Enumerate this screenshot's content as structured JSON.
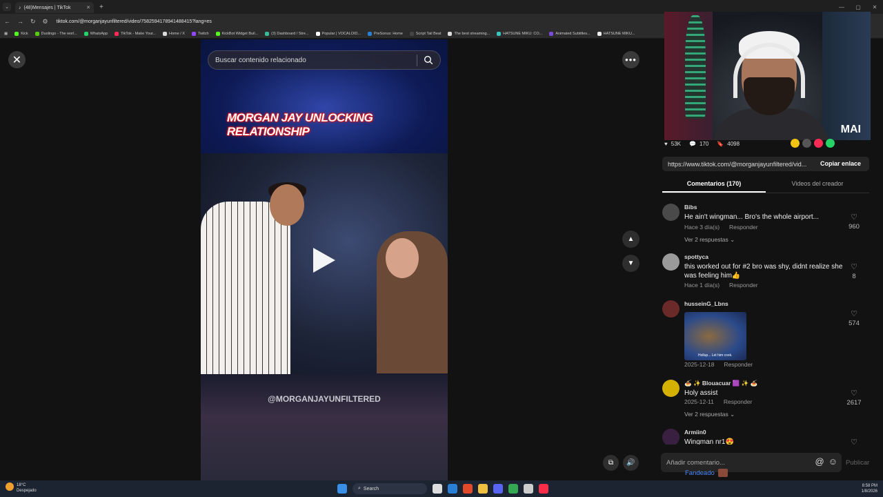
{
  "browser": {
    "tab_title": "(48)Mensajes | TikTok",
    "url": "tiktok.com/@morganjayunfiltered/video/7582594178941488415?lang=es",
    "bookmarks": [
      "Kick",
      "Duolingo - The worl...",
      "WhatsApp",
      "TikTok - Make Your...",
      "Home / X",
      "Twitch",
      "KickBot Widget Buil...",
      "(3) Dashboard / Stre...",
      "Popular | VOCALOID...",
      "PreSonus: Home",
      "Script Tail Beat",
      "The best streaming...",
      "HATSUNE MIKU: CO...",
      "Animated Subtitles...",
      "HATSUNE MIKU..."
    ]
  },
  "search": {
    "placeholder": "Buscar contenido relacionado"
  },
  "video": {
    "title_overlay": "MORGAN JAY UNLOCKING RELATIONSHIP",
    "handle_overlay": "@MORGANJAYUNFILTERED"
  },
  "stats": {
    "likes": "53K",
    "comments": "170",
    "saves": "4098"
  },
  "link": {
    "url": "https://www.tiktok.com/@morganjayunfiltered/vid...",
    "copy_label": "Copiar enlace"
  },
  "tabs": {
    "comments": "Comentarios (170)",
    "creator_videos": "Videos del creador"
  },
  "comments": [
    {
      "user": "Bibs",
      "text": "He ain't wingman... Bro's the whole airport...",
      "date": "Hace 3 día(s)",
      "reply": "Responder",
      "likes": "960",
      "replies": "Ver 2 respuestas"
    },
    {
      "user": "spottyca",
      "text": "this worked out for #2 bro was shy, didnt realize she was feeling him👍",
      "date": "Hace 1 día(s)",
      "reply": "Responder",
      "likes": "8"
    },
    {
      "user": "husseinG_Lbns",
      "text": "",
      "gif_caption": "Hollup... Let him cook.",
      "date": "2025-12-18",
      "reply": "Responder",
      "likes": "574"
    },
    {
      "user": "🍝 ✨ Blouacuar 🟪 ✨ 🍝",
      "text": "Holy assist",
      "date": "2025-12-11",
      "reply": "Responder",
      "likes": "2617",
      "replies": "Ver 2 respuestas"
    },
    {
      "user": "Armiin0",
      "text": "Wingman nr1😍",
      "likes": ""
    }
  ],
  "comment_input": {
    "placeholder": "Añadir comentario...",
    "publish": "Publicar"
  },
  "fandom_label": "Fandeado",
  "webcam": {
    "logo": "MAI"
  },
  "taskbar": {
    "temp": "18°C",
    "weather": "Despejado",
    "search": "Search",
    "time": "8:58 PM",
    "date": "1/8/2026"
  }
}
